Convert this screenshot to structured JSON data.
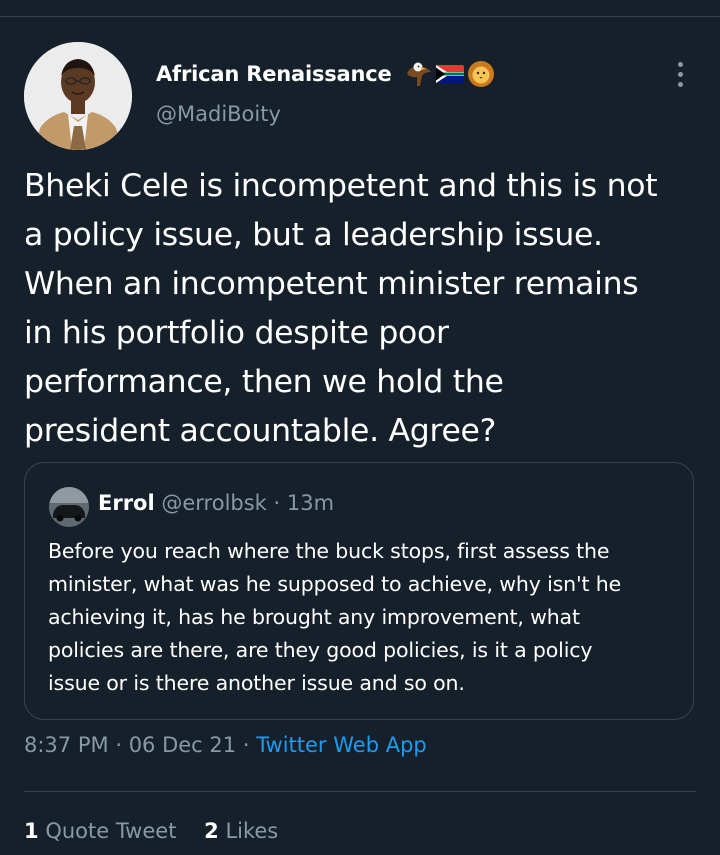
{
  "author": {
    "display_name": "African Renaissance",
    "emoji": [
      "eagle-emoji",
      "south-africa-flag-emoji",
      "lion-emoji"
    ],
    "handle": "@MadiBoity"
  },
  "tweet": {
    "text": "Bheki Cele is incompetent and this is not\na policy issue, but a leadership issue.\nWhen an incompetent minister remains\nin his portfolio despite poor\nperformance, then we hold the\npresident accountable. Agree?"
  },
  "quoted_tweet": {
    "display_name": "Errol",
    "handle": "@errolbsk",
    "separator": "·",
    "time": "13m",
    "text": "Before you reach where the buck stops, first assess the\nminister, what was he supposed to achieve, why isn't he\nachieving it, has he brought any improvement, what\npolicies are there, are they good policies, is it a policy\nissue or is there another issue and so on."
  },
  "meta": {
    "time": "8:37 PM",
    "separator": "·",
    "date": "06 Dec 21",
    "source": "Twitter Web App"
  },
  "stats": {
    "quote_count": "1",
    "quote_label": "Quote Tweet",
    "like_count": "2",
    "like_label": "Likes"
  },
  "colors": {
    "background": "#15202b",
    "secondary_text": "#8899a6",
    "link": "#1d9bf0",
    "divider": "#38444d"
  }
}
